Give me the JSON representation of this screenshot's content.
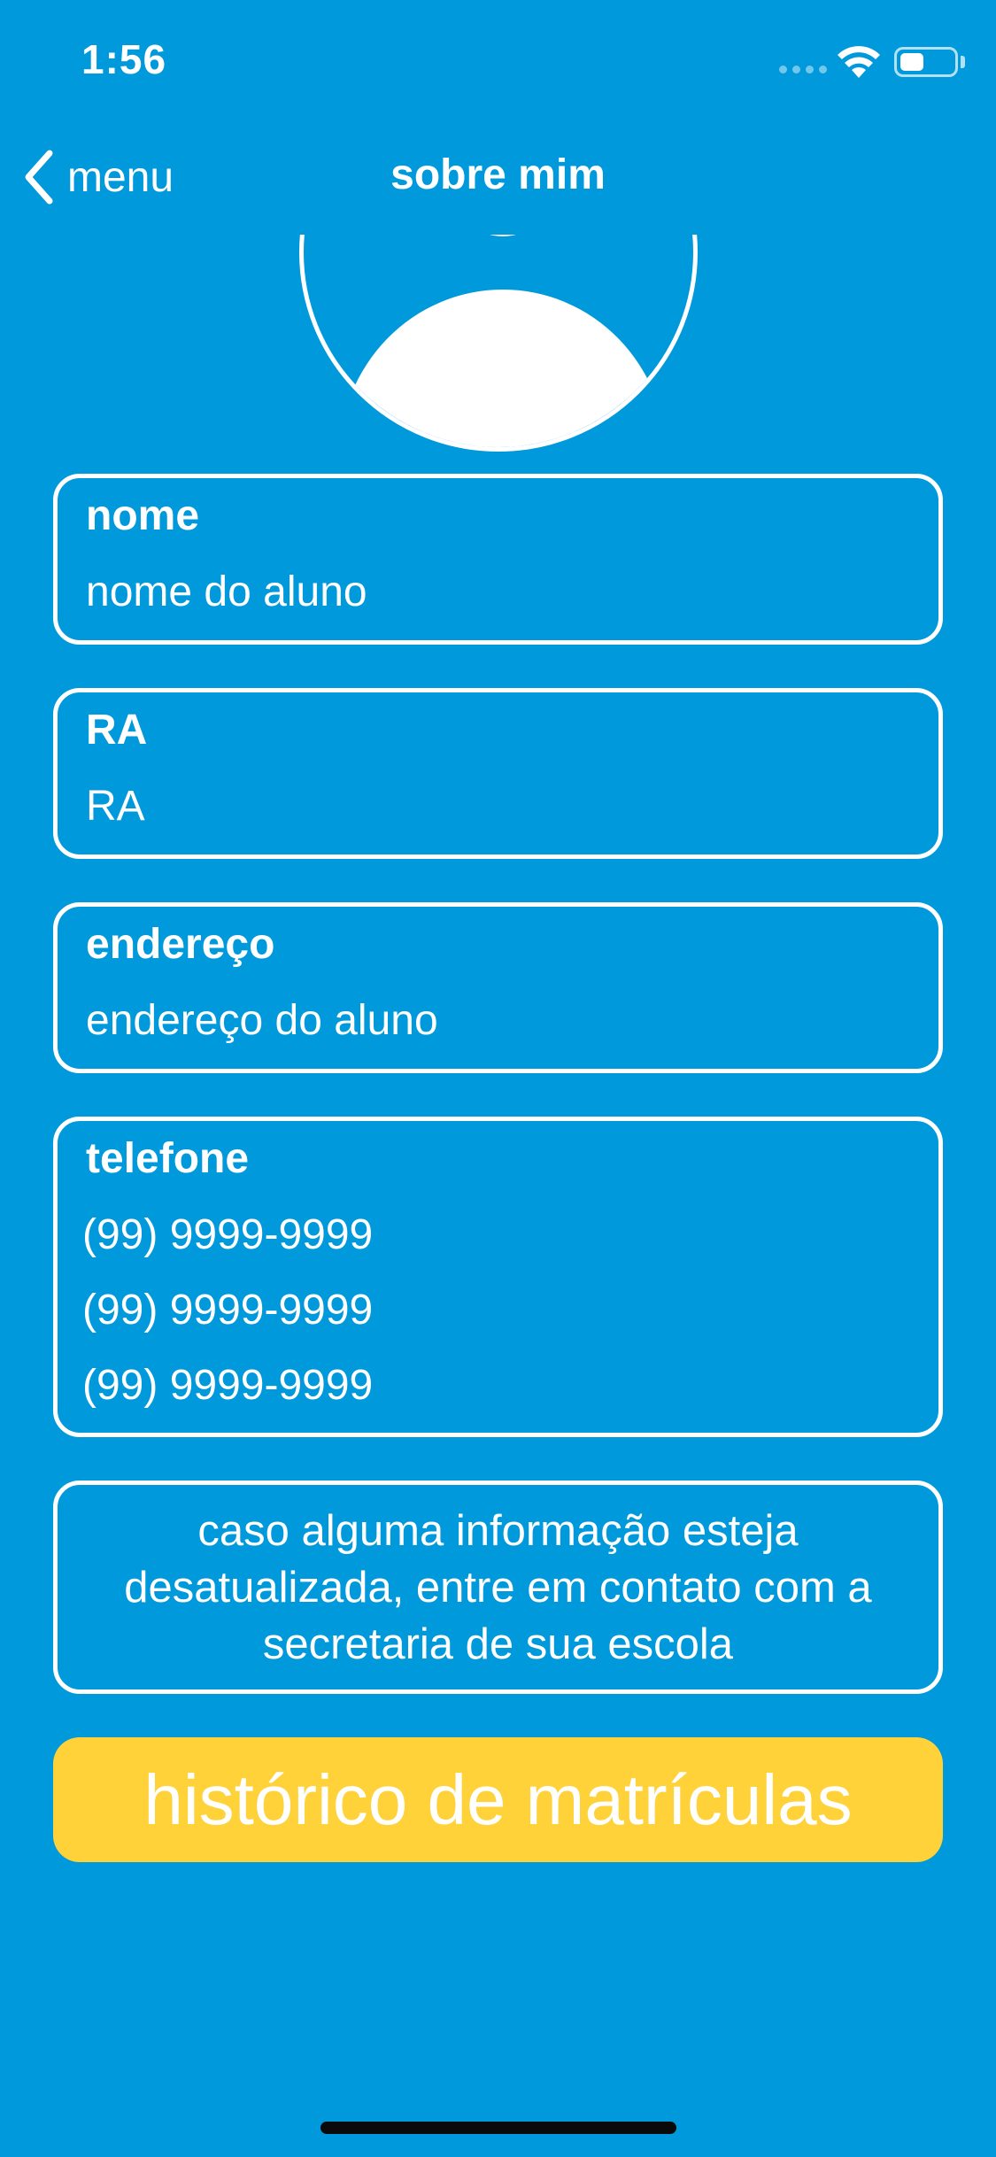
{
  "status_bar": {
    "time": "1:56",
    "battery_level": 0.45,
    "icons": [
      "signal-dots-icon",
      "wifi-icon",
      "battery-icon"
    ]
  },
  "nav": {
    "back_label": "menu",
    "title": "sobre mim"
  },
  "fields": {
    "name": {
      "label": "nome",
      "value": "nome do aluno"
    },
    "ra": {
      "label": "RA",
      "value": "RA"
    },
    "address": {
      "label": "endereço",
      "value": "endereço do aluno"
    },
    "phone": {
      "label": "telefone",
      "values": [
        "(99) 9999-9999",
        "(99) 9999-9999",
        "(99) 9999-9999"
      ]
    }
  },
  "notice": {
    "text": "caso alguma informação esteja desatualizada, entre em contato com a secretaria de sua escola"
  },
  "history_button": {
    "label": "histórico de matrículas"
  },
  "colors": {
    "background": "#0099DB",
    "button": "#FFD23A",
    "text": "#FFFFFF"
  }
}
